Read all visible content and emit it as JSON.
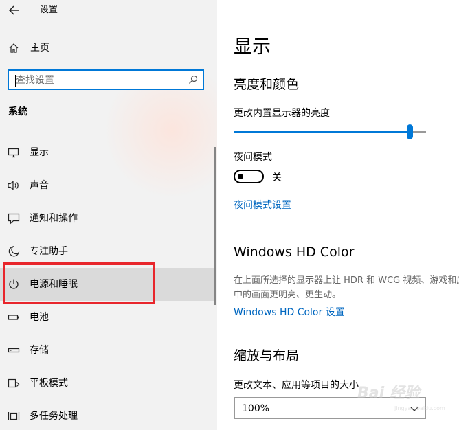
{
  "window": {
    "title": "设置"
  },
  "sidebar": {
    "home_label": "主页",
    "search": {
      "placeholder": "查找设置",
      "value": ""
    },
    "section_title": "系统",
    "items": [
      {
        "label": "显示",
        "icon": "monitor-icon"
      },
      {
        "label": "声音",
        "icon": "speaker-icon"
      },
      {
        "label": "通知和操作",
        "icon": "notification-icon"
      },
      {
        "label": "专注助手",
        "icon": "moon-icon"
      },
      {
        "label": "电源和睡眠",
        "icon": "power-icon",
        "selected": true
      },
      {
        "label": "电池",
        "icon": "battery-icon"
      },
      {
        "label": "存储",
        "icon": "storage-icon"
      },
      {
        "label": "平板模式",
        "icon": "tablet-mode-icon"
      },
      {
        "label": "多任务处理",
        "icon": "multitasking-icon"
      }
    ]
  },
  "main": {
    "page_title": "显示",
    "brightness": {
      "heading": "亮度和颜色",
      "slider_label": "更改内置显示器的亮度",
      "slider_fraction": 0.9
    },
    "night_light": {
      "label": "夜间模式",
      "toggle_state": "关",
      "settings_link": "夜间模式设置"
    },
    "hdr": {
      "heading": "Windows HD Color",
      "description": "在上面所选择的显示器上让 HDR 和 WCG 视频、游戏和应用中的画面更明亮、更生动。",
      "link": "Windows HD Color 设置"
    },
    "scale": {
      "heading": "缩放与布局",
      "label": "更改文本、应用等项目的大小",
      "value": "100%"
    }
  },
  "colors": {
    "accent": "#0078d7",
    "link": "#0067c0",
    "highlight_box": "#e8262c",
    "sidebar_bg": "#f2f2f2",
    "selected_bg": "#dadada"
  },
  "watermark": {
    "text": "Bai 经验",
    "sub": "jingyan.baidu.com"
  }
}
